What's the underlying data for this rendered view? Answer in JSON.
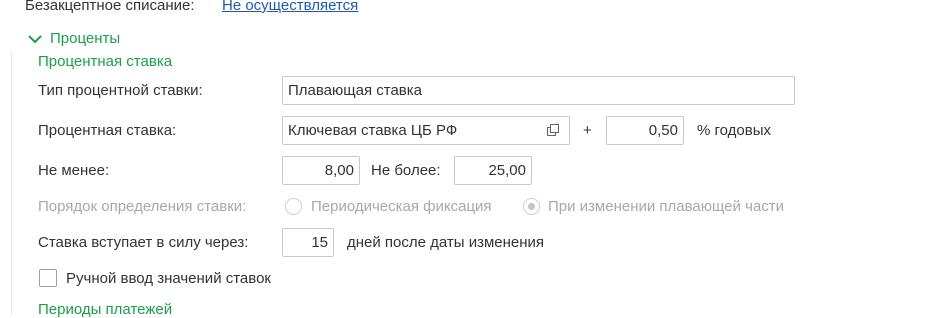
{
  "writeoff": {
    "label": "Безакцептное списание:",
    "value": "Не осуществляется"
  },
  "section": {
    "title": "Проценты",
    "toggle_icon": "chevron-down-icon",
    "group_title": "Процентная ставка"
  },
  "rate_type": {
    "label": "Тип процентной ставки:",
    "value": "Плавающая ставка"
  },
  "rate": {
    "label": "Процентная ставка:",
    "base_value": "Ключевая ставка ЦБ РФ",
    "open_icon": "open-form-icon",
    "plus": "+",
    "margin_value": "0,50",
    "unit": "% годовых"
  },
  "limits": {
    "min_label": "Не менее:",
    "min_value": "8,00",
    "max_label": "Не более:",
    "max_value": "25,00"
  },
  "order": {
    "label": "Порядок определения ставки:",
    "option1": "Периодическая фиксация",
    "option2": "При изменении плавающей части",
    "selected": "option2"
  },
  "effective": {
    "label": "Ставка вступает в силу через:",
    "value": "15",
    "suffix": "дней после даты изменения"
  },
  "manual": {
    "label": "Ручной ввод значений ставок",
    "checked": false
  },
  "next_section": {
    "title": "Периоды платежей"
  },
  "colors": {
    "accent_green": "#1a9f4b",
    "link_blue": "#1f5aa8",
    "disabled_gray": "#a8a8a8"
  }
}
